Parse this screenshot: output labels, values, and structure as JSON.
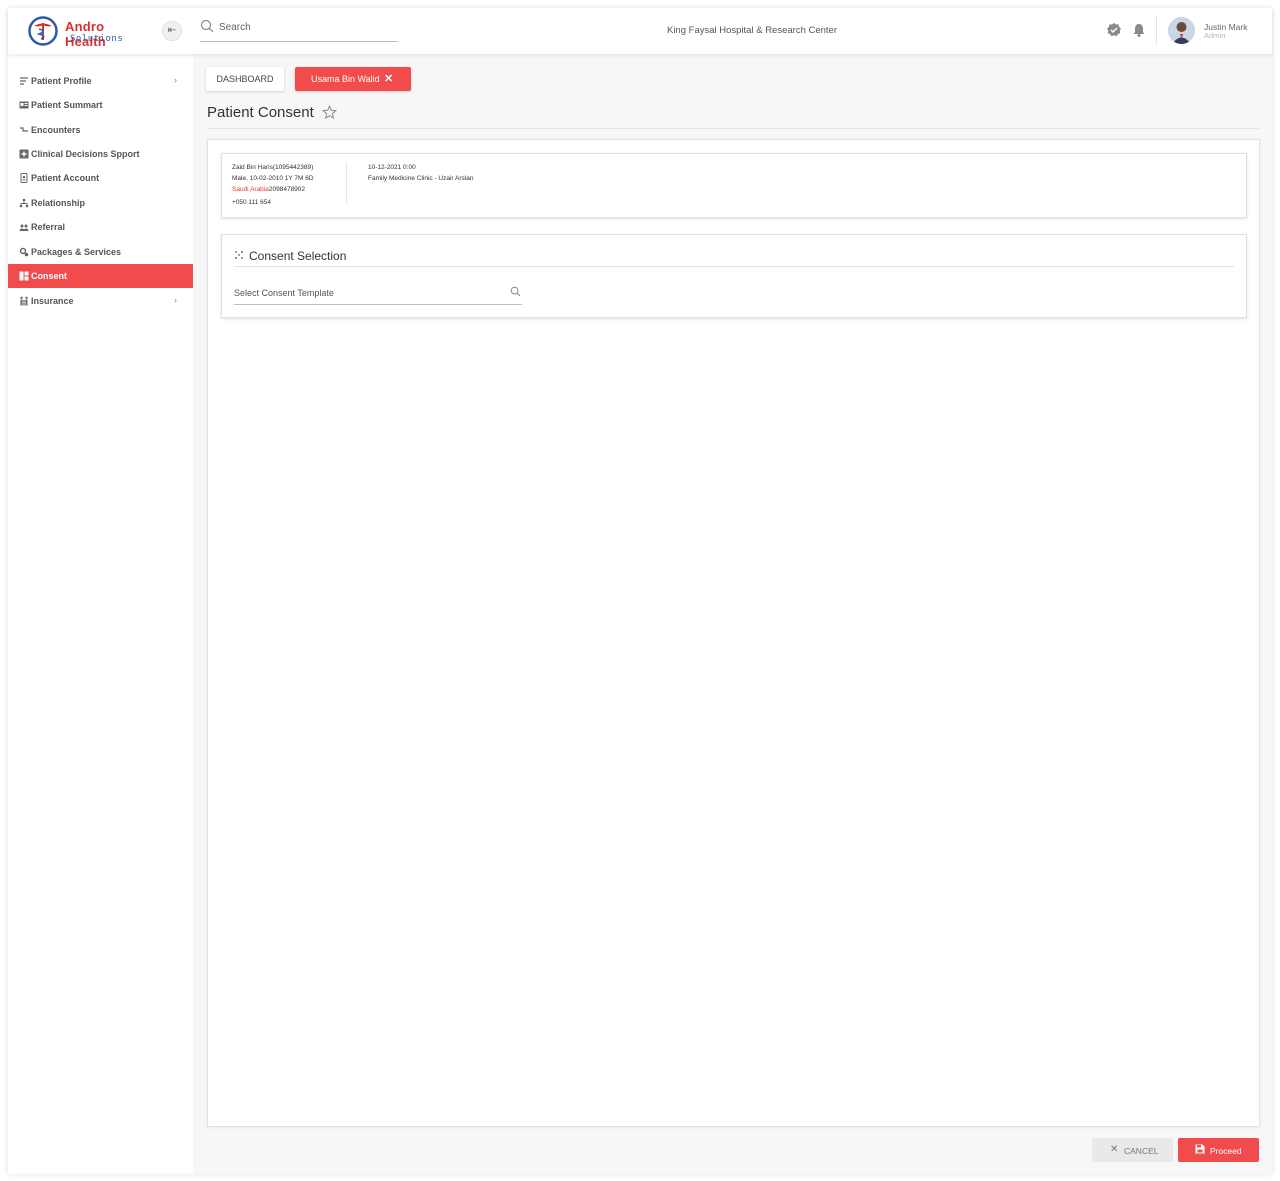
{
  "brand": {
    "name": "Andro Health",
    "tagline": "Solutions"
  },
  "header": {
    "search_placeholder": "Search",
    "organization": "King Faysal Hospital & Research Center",
    "user": {
      "name": "Justin Mark",
      "role": "Admin"
    }
  },
  "sidebar": {
    "items": [
      {
        "label": "Patient Profile",
        "icon": "list-filter-icon",
        "has_submenu": true
      },
      {
        "label": "Patient Summart",
        "icon": "id-card-icon",
        "has_submenu": false
      },
      {
        "label": "Encounters",
        "icon": "flow-icon",
        "has_submenu": false
      },
      {
        "label": "Clinical Decisions Spport",
        "icon": "medical-plus-icon",
        "has_submenu": false
      },
      {
        "label": "Patient Account",
        "icon": "account-file-icon",
        "has_submenu": false
      },
      {
        "label": "Relationship",
        "icon": "people-tree-icon",
        "has_submenu": false
      },
      {
        "label": "Referral",
        "icon": "group-icon",
        "has_submenu": false
      },
      {
        "label": "Packages & Services",
        "icon": "gears-icon",
        "has_submenu": false
      },
      {
        "label": "Consent",
        "icon": "dashboard-icon",
        "has_submenu": false,
        "active": true
      },
      {
        "label": "Insurance",
        "icon": "family-icon",
        "has_submenu": true
      }
    ]
  },
  "tabs": [
    {
      "label": "DASHBOARD"
    },
    {
      "label": "Usama Bin Walid",
      "close": "✕"
    }
  ],
  "page": {
    "title": "Patient Consent"
  },
  "patient": {
    "name_id": "Zaid Bin Haris(1095442389)",
    "demographics": "Male, 10-02-2010 1Y 7M 6D",
    "country": "Saudi Arabia",
    "national_id": "2098478902",
    "phone": "+050 111 654",
    "visit_datetime": "10-12-2021 0:00",
    "clinic_doctor": "Family Medicine Clinic - Uzair Arslan"
  },
  "consent_section": {
    "title": "Consent Selection",
    "template_placeholder": "Select Consent Template"
  },
  "actions": {
    "cancel": "CANCEL",
    "proceed": "Proceed"
  },
  "colors": {
    "accent": "#f24b4b",
    "brand_red": "#d9302f",
    "brand_blue": "#2b5aa8"
  }
}
